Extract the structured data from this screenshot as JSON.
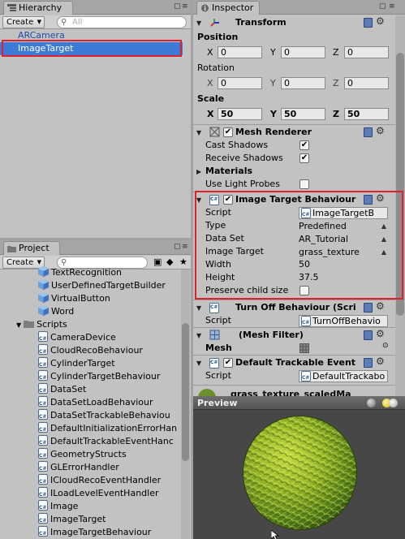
{
  "hierarchy": {
    "tab_label": "Hierarchy",
    "create_label": "Create",
    "search_placeholder": "All",
    "items": [
      {
        "label": "ARCamera",
        "selected": false
      },
      {
        "label": "ImageTarget",
        "selected": true
      }
    ]
  },
  "project": {
    "tab_label": "Project",
    "create_label": "Create",
    "items": [
      {
        "label": "TextRecognition",
        "icon": "cube-icon",
        "indent": 1
      },
      {
        "label": "UserDefinedTargetBuilder",
        "icon": "cube-icon",
        "indent": 1
      },
      {
        "label": "VirtualButton",
        "icon": "cube-icon",
        "indent": 1
      },
      {
        "label": "Word",
        "icon": "cube-icon",
        "indent": 1
      },
      {
        "label": "Scripts",
        "icon": "folder-icon",
        "indent": 0
      },
      {
        "label": "CameraDevice",
        "icon": "script-icon",
        "indent": 1
      },
      {
        "label": "CloudRecoBehaviour",
        "icon": "script-icon",
        "indent": 1
      },
      {
        "label": "CylinderTarget",
        "icon": "script-icon",
        "indent": 1
      },
      {
        "label": "CylinderTargetBehaviour",
        "icon": "script-icon",
        "indent": 1
      },
      {
        "label": "DataSet",
        "icon": "script-icon",
        "indent": 1
      },
      {
        "label": "DataSetLoadBehaviour",
        "icon": "script-icon",
        "indent": 1
      },
      {
        "label": "DataSetTrackableBehaviou",
        "icon": "script-icon",
        "indent": 1
      },
      {
        "label": "DefaultInitializationErrorHan",
        "icon": "script-icon",
        "indent": 1
      },
      {
        "label": "DefaultTrackableEventHanc",
        "icon": "script-icon",
        "indent": 1
      },
      {
        "label": "GeometryStructs",
        "icon": "script-icon",
        "indent": 1
      },
      {
        "label": "GLErrorHandler",
        "icon": "script-icon",
        "indent": 1
      },
      {
        "label": "ICloudRecoEventHandler",
        "icon": "script-icon",
        "indent": 1
      },
      {
        "label": "ILoadLevelEventHandler",
        "icon": "script-icon",
        "indent": 1
      },
      {
        "label": "Image",
        "icon": "script-icon",
        "indent": 1
      },
      {
        "label": "ImageTarget",
        "icon": "script-icon",
        "indent": 1
      },
      {
        "label": "ImageTargetBehaviour",
        "icon": "script-icon",
        "indent": 1
      }
    ]
  },
  "inspector": {
    "tab_label": "Inspector",
    "transform": {
      "title": "Transform",
      "position_label": "Position",
      "rotation_label": "Rotation",
      "scale_label": "Scale",
      "axis_x": "X",
      "axis_y": "Y",
      "axis_z": "Z",
      "position": {
        "x": "0",
        "y": "0",
        "z": "0"
      },
      "rotation": {
        "x": "0",
        "y": "0",
        "z": "0"
      },
      "scale": {
        "x": "50",
        "y": "50",
        "z": "50"
      }
    },
    "mesh_renderer": {
      "title": "Mesh Renderer",
      "cast_shadows_label": "Cast Shadows",
      "receive_shadows_label": "Receive Shadows",
      "materials_label": "Materials",
      "use_light_probes_label": "Use Light Probes",
      "cast_shadows": true,
      "receive_shadows": true,
      "use_light_probes": false
    },
    "image_target_behaviour": {
      "title": "Image Target Behaviour",
      "script_label": "Script",
      "script_value": "ImageTargetB",
      "type_label": "Type",
      "type_value": "Predefined",
      "dataset_label": "Data Set",
      "dataset_value": "AR_Tutorial",
      "image_target_label": "Image Target",
      "image_target_value": "grass_texture",
      "width_label": "Width",
      "width_value": "50",
      "height_label": "Height",
      "height_value": "37.5",
      "preserve_label": "Preserve child size",
      "preserve_checked": false
    },
    "turn_off": {
      "title": "Turn Off Behaviour (Scri",
      "script_label": "Script",
      "script_value": "TurnOffBehavio"
    },
    "mesh_filter": {
      "title": "(Mesh Filter)",
      "mesh_label": "Mesh"
    },
    "default_trackable": {
      "title": "Default Trackable Event",
      "script_label": "Script",
      "script_value": "DefaultTrackabo"
    },
    "material_partial": "grass_texture_scaledMa"
  },
  "preview": {
    "title": "Preview"
  },
  "colors": {
    "selection": "#3d7bd8",
    "highlight_box": "#e0202a",
    "panel_bg": "#c2c2c2",
    "preview_bg": "#474747",
    "grass_dark": "#3c6b0f",
    "grass_light": "#b8d42e"
  }
}
